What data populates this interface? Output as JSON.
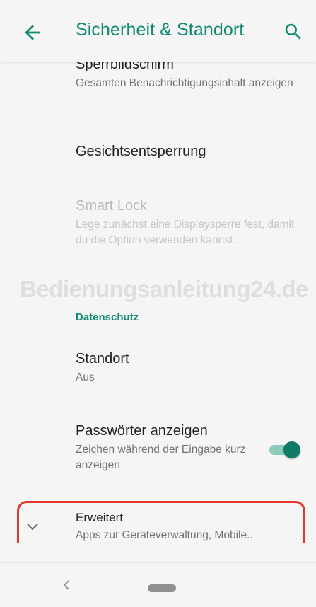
{
  "appbar": {
    "title": "Sicherheit & Standort",
    "back_icon": "arrow-back-icon",
    "search_icon": "search-icon"
  },
  "items": {
    "lockscreen": {
      "title": "Sperrbildschirm",
      "summary": "Gesamten Benachrichtigungsinhalt anzeigen"
    },
    "face_unlock": {
      "title": "Gesichtsentsperrung"
    },
    "smart_lock": {
      "title": "Smart Lock",
      "summary": "Lege zunächst eine Displaysperre fest, damit du die Option verwenden kannst."
    },
    "privacy_header": "Datenschutz",
    "location": {
      "title": "Standort",
      "summary": "Aus"
    },
    "show_passwords": {
      "title": "Passwörter anzeigen",
      "summary": "Zeichen während der Eingabe kurz anzeigen",
      "enabled": true
    },
    "advanced": {
      "title": "Erweitert",
      "summary": "Apps zur Geräteverwaltung, Mobile.."
    }
  },
  "watermark": "Bedienungsanleitung24.de",
  "colors": {
    "accent": "#138a72",
    "toggle_thumb": "#0f7a66",
    "toggle_track": "#8ccab9",
    "highlight": "#e0392b"
  }
}
